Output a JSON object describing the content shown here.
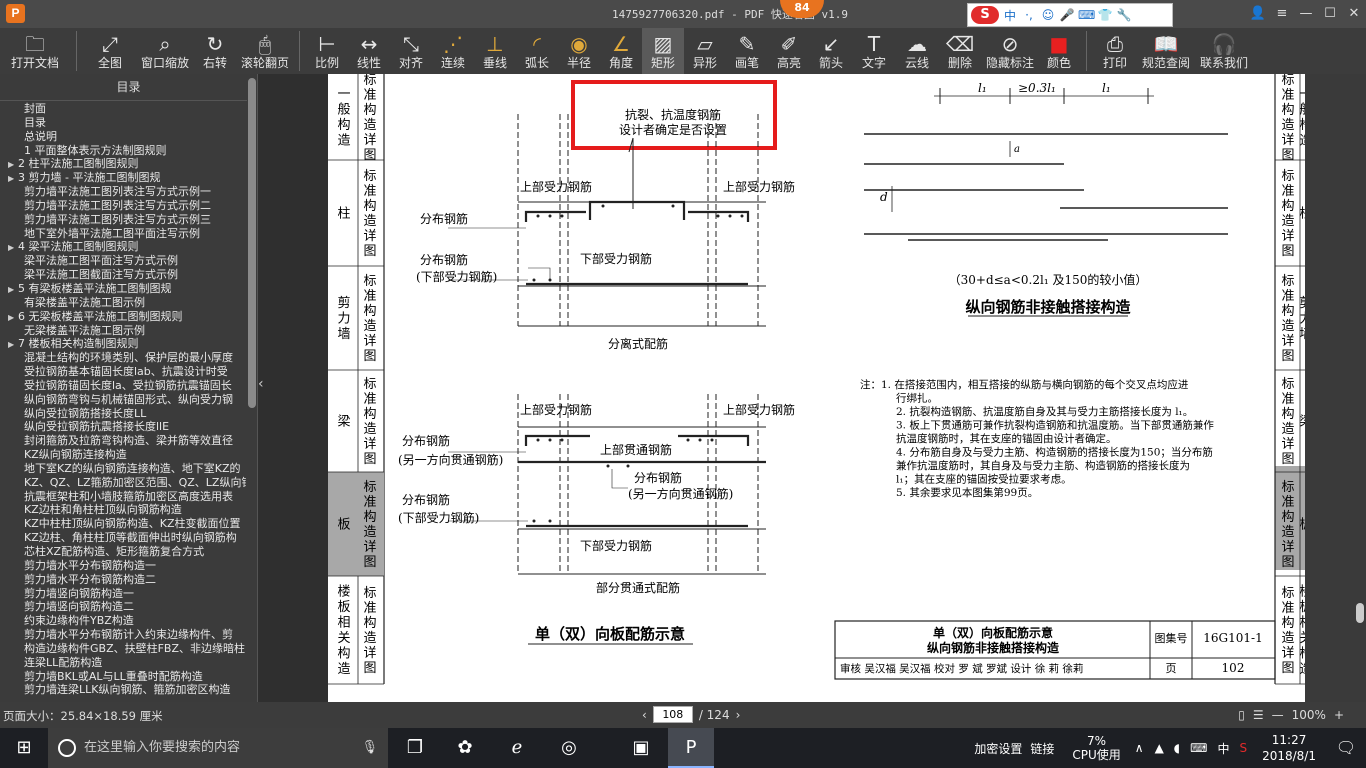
{
  "window": {
    "title": "1475927706320.pdf - PDF 快速看图 v1.9",
    "logo": "P",
    "badge": "84",
    "controls": [
      "user-icon",
      "menu-icon",
      "minimize-icon",
      "maximize-icon",
      "close-icon"
    ]
  },
  "ime": {
    "s": "S",
    "zh": "中",
    "dot": "·,",
    "emoji": "☺",
    "mic": "🎤",
    "kb": "⌨",
    "shirt": "👕",
    "tool": "🔧"
  },
  "toolbar": [
    {
      "name": "open-file",
      "label": "打开文档",
      "icon": "folder-icon"
    },
    {
      "name": "fit-all",
      "label": "全图",
      "icon": "fit-icon"
    },
    {
      "name": "window-zoom",
      "label": "窗口缩放",
      "icon": "magnifier-icon"
    },
    {
      "name": "rotate-right",
      "label": "右转",
      "icon": "rotate-icon"
    },
    {
      "name": "scroll-page",
      "label": "滚轮翻页",
      "icon": "mouse-icon"
    },
    {
      "name": "scale",
      "label": "比例",
      "icon": "ruler-icon"
    },
    {
      "name": "linear",
      "label": "线性",
      "icon": "linear-dim-icon"
    },
    {
      "name": "aligned",
      "label": "对齐",
      "icon": "aligned-dim-icon"
    },
    {
      "name": "continuous",
      "label": "连续",
      "icon": "continuous-icon"
    },
    {
      "name": "perpendicular",
      "label": "垂线",
      "icon": "perpendicular-icon"
    },
    {
      "name": "arc-length",
      "label": "弧长",
      "icon": "arc-icon"
    },
    {
      "name": "radius",
      "label": "半径",
      "icon": "radius-icon"
    },
    {
      "name": "angle",
      "label": "角度",
      "icon": "angle-icon"
    },
    {
      "name": "rectangle",
      "label": "矩形",
      "icon": "rectangle-icon"
    },
    {
      "name": "irregular",
      "label": "异形",
      "icon": "irregular-icon"
    },
    {
      "name": "brush",
      "label": "画笔",
      "icon": "pen-icon"
    },
    {
      "name": "highlight",
      "label": "高亮",
      "icon": "highlighter-icon"
    },
    {
      "name": "arrow",
      "label": "箭头",
      "icon": "arrow-icon"
    },
    {
      "name": "text",
      "label": "文字",
      "icon": "text-icon"
    },
    {
      "name": "cloud",
      "label": "云线",
      "icon": "cloud-icon"
    },
    {
      "name": "delete",
      "label": "删除",
      "icon": "eraser-icon"
    },
    {
      "name": "hide-marks",
      "label": "隐藏标注",
      "icon": "eye-hide-icon"
    },
    {
      "name": "color",
      "label": "颜色",
      "icon": "color-swatch-icon"
    },
    {
      "name": "print",
      "label": "打印",
      "icon": "printer-icon"
    },
    {
      "name": "spec-lookup",
      "label": "规范查阅",
      "icon": "book-icon"
    },
    {
      "name": "contact",
      "label": "联系我们",
      "icon": "support-icon"
    }
  ],
  "toc": {
    "title": "目录",
    "items": [
      {
        "t": "封面",
        "e": false
      },
      {
        "t": "目录",
        "e": false
      },
      {
        "t": "总说明",
        "e": false
      },
      {
        "t": "1  平面整体表示方法制图规则",
        "e": false
      },
      {
        "t": "2  柱平法施工图制图规则",
        "e": true
      },
      {
        "t": "3  剪力墙 - 平法施工图制图规",
        "e": true
      },
      {
        "t": "剪力墙平法施工图列表注写方式示例一",
        "e": false
      },
      {
        "t": "剪力墙平法施工图列表注写方式示例二",
        "e": false
      },
      {
        "t": "剪力墙平法施工图列表注写方式示例三",
        "e": false
      },
      {
        "t": "地下室外墙平法施工图平面注写示例",
        "e": false
      },
      {
        "t": "4  梁平法施工图制图规则",
        "e": true
      },
      {
        "t": "梁平法施工图平面注写方式示例",
        "e": false
      },
      {
        "t": "梁平法施工图截面注写方式示例",
        "e": false
      },
      {
        "t": "5  有梁板楼盖平法施工图制图规",
        "e": true
      },
      {
        "t": "有梁楼盖平法施工图示例",
        "e": false
      },
      {
        "t": "6  无梁板楼盖平法施工图制图规则",
        "e": true
      },
      {
        "t": "无梁楼盖平法施工图示例",
        "e": false
      },
      {
        "t": "7  楼板相关构造制图规则",
        "e": true
      },
      {
        "t": "混凝土结构的环境类别、保护层的最小厚度",
        "e": false
      },
      {
        "t": "受拉钢筋基本锚固长度lab、抗震设计时受",
        "e": false
      },
      {
        "t": "受拉钢筋锚固长度la、受拉钢筋抗震锚固长",
        "e": false
      },
      {
        "t": "纵向钢筋弯钩与机械锚固形式、纵向受力钢",
        "e": false
      },
      {
        "t": "纵向受拉钢筋搭接长度LL",
        "e": false
      },
      {
        "t": "纵向受拉钢筋抗震搭接长度llE",
        "e": false
      },
      {
        "t": "封闭箍筋及拉筋弯钩构造、梁并筋等效直径",
        "e": false
      },
      {
        "t": "KZ纵向钢筋连接构造",
        "e": false
      },
      {
        "t": "地下室KZ的纵向钢筋连接构造、地下室KZ的",
        "e": false
      },
      {
        "t": "KZ、QZ、LZ箍筋加密区范围、QZ、LZ纵向钢",
        "e": false
      },
      {
        "t": "抗震框架柱和小墙肢箍筋加密区高度选用表",
        "e": false
      },
      {
        "t": "KZ边柱和角柱柱顶纵向钢筋构造",
        "e": false
      },
      {
        "t": "KZ中柱柱顶纵向钢筋构造、KZ柱变截面位置",
        "e": false
      },
      {
        "t": "KZ边柱、角柱柱顶等截面伸出时纵向钢筋构",
        "e": false
      },
      {
        "t": "芯柱XZ配筋构造、矩形箍筋复合方式",
        "e": false
      },
      {
        "t": "剪力墙水平分布钢筋构造一",
        "e": false
      },
      {
        "t": "剪力墙水平分布钢筋构造二",
        "e": false
      },
      {
        "t": "剪力墙竖向钢筋构造一",
        "e": false
      },
      {
        "t": "剪力墙竖向钢筋构造二",
        "e": false
      },
      {
        "t": "约束边缘构件YBZ构造",
        "e": false
      },
      {
        "t": "剪力墙水平分布钢筋计入约束边缘构件、剪",
        "e": false
      },
      {
        "t": "构造边缘构件GBZ、扶壁柱FBZ、非边缘暗柱",
        "e": false
      },
      {
        "t": "连梁LL配筋构造",
        "e": false
      },
      {
        "t": "剪力墙BKL或AL与LL重叠时配筋构造",
        "e": false
      },
      {
        "t": "剪力墙连梁LLK纵向钢筋、箍筋加密区构造",
        "e": false
      }
    ]
  },
  "drawing": {
    "left_tabs": [
      {
        "a": "一般构造",
        "b": "标准构造详图"
      },
      {
        "a": "柱",
        "b": "标准构造详图"
      },
      {
        "a": "剪力墙",
        "b": "标准构造详图"
      },
      {
        "a": "梁",
        "b": "标准构造详图"
      },
      {
        "a": "板",
        "b": "标准构造详图"
      },
      {
        "a": "楼板相关构造",
        "b": "标准构造详图"
      }
    ],
    "right_tabs": [
      {
        "a": "一般构造",
        "b": "标准构造详图"
      },
      {
        "a": "柱",
        "b": "标准构造详图"
      },
      {
        "a": "剪力墙",
        "b": "标准构造详图"
      },
      {
        "a": "梁",
        "b": "标准构造详图"
      },
      {
        "a": "板",
        "b": "标准构造详图"
      },
      {
        "a": "楼板相关构造",
        "b": "标准构造详图"
      }
    ],
    "highlight_note_1": "抗裂、抗温度钢筋",
    "highlight_note_2": "设计者确定是否设置",
    "upper_rebar_l": "上部受力钢筋",
    "upper_rebar_r": "上部受力钢筋",
    "dist_rebar": "分布钢筋",
    "dist_rebar_2": "分布钢筋",
    "lower_rebar_paren": "(下部受力钢筋)",
    "lower_rebar": "下部受力钢筋",
    "separate_caption": "分离式配筋",
    "upper_rebar_l2": "上部受力钢筋",
    "upper_rebar_r2": "上部受力钢筋",
    "dist_rebar_3": "分布钢筋",
    "through_rebar_paren": "(另一方向贯通钢筋)",
    "upper_through": "上部贯通钢筋",
    "dist_rebar_4": "分布钢筋",
    "other_through_paren": "(另一方向贯通钢筋)",
    "dist_rebar_5": "分布钢筋",
    "lower_rebar_paren2": "(下部受力钢筋)",
    "lower_rebar_2": "下部受力钢筋",
    "partial_caption": "部分贯通式配筋",
    "main_title": "单（双）向板配筋示意",
    "dim_l1_left": "l₁",
    "dim_mid": "≥0.3l₁",
    "dim_l1_right": "l₁",
    "dim_d": "d",
    "dim_a": "a",
    "formula": "（30+d≤a<0.2l₁ 及150的较小值）",
    "splice_title": "纵向钢筋非接触搭接构造",
    "notes": [
      "注：1. 在搭接范围内，相互搭接的纵筋与横向钢筋的每个交叉点均应进",
      "行绑扎。",
      "2. 抗裂构造钢筋、抗温度筋自身及其与受力主筋搭接长度为 l₁。",
      "3. 板上下贯通筋可兼作抗裂构造钢筋和抗温度筋。当下部贯通筋兼作",
      "抗温度钢筋时，其在支座的锚固由设计者确定。",
      "4. 分布筋自身及与受力主筋、构造钢筋的搭接长度为150；当分布筋",
      "兼作抗温度筋时，其自身及与受力主筋、构造钢筋的搭接长度为",
      "l₁；其在支座的锚固按受拉要求考虑。",
      "5. 其余要求见本图集第99页。"
    ],
    "titleblock": {
      "title1": "单（双）向板配筋示意",
      "title2": "纵向钢筋非接触搭接构造",
      "atlas_label": "图集号",
      "atlas_no": "16G101-1",
      "page_label": "页",
      "page_no": "102",
      "row": "审核 吴汉福 吴汉福 校对 罗 斌 罗斌 设计 徐 莉 徐莉"
    }
  },
  "status": {
    "page_size": "页面大小：25.84×18.59 厘米",
    "current_page": "108",
    "total_pages": "/ 124",
    "zoom": "100%"
  },
  "taskbar": {
    "search_placeholder": "在这里输入你要搜索的内容",
    "tray_text_1": "加密",
    "tray_text_2": "设置",
    "tray_text_3": "链接",
    "cpu_pct": "7%",
    "cpu_label": "CPU使用",
    "ime": "中",
    "time": "11:27",
    "date": "2018/8/1"
  },
  "colors": {
    "highlight_box": "#e51b1b",
    "app_accent": "#e8731f",
    "tab_active": "#a8a8a8"
  }
}
